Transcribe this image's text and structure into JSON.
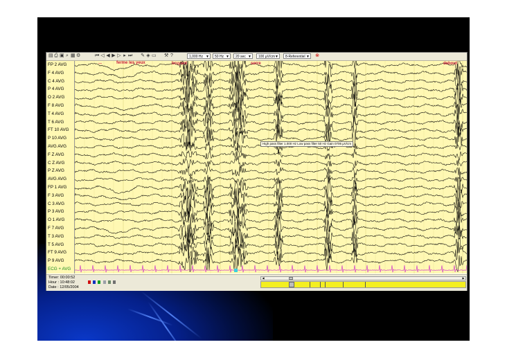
{
  "toolbar": {
    "icons": [
      "open-icon",
      "print-icon",
      "save-icon",
      "zoom-icon",
      "montage-icon",
      "settings-icon",
      "first-page-icon",
      "previous-icon",
      "back-icon",
      "play-icon",
      "forward-icon",
      "next-icon",
      "last-page-icon",
      "marker-icon",
      "filter-icon",
      "video-icon",
      "tools-icon",
      "help-icon"
    ],
    "high_pass": "1,000 Hz",
    "low_pass": "50 Hz",
    "time_base": "20 sec",
    "gain": "100 µV/cm",
    "montage": "8-Referentiel"
  },
  "channels": [
    "FP 2 AVG",
    "F 4 AVG",
    "C 4 AVG",
    "P 4 AVG",
    "O 2 AVG",
    "F 8 AVG",
    "T 4 AVG",
    "T 6 AVG",
    "FT 10 AVG",
    "P 10 AVG",
    "AVG AVG",
    "F Z AVG",
    "C Z AVG",
    "P Z AVG",
    "AVG AVG",
    "FP 1 AVG",
    "F 3 AVG",
    "C 3 AVG",
    "P 3 AVG",
    "O 1 AVG",
    "F 7 AVG",
    "T 3 AVG",
    "T 5 AVG",
    "FT 9 AVG",
    "P 9 AVG",
    "ECG + AVG"
  ],
  "annotations": [
    "...",
    "ferme les yeux",
    "bruyant",
    "serre",
    "debout"
  ],
  "filter_info": "High pass filter 1.000 Hz   Low pass filter 50 Hz   Gain 0706 µV/cm",
  "status": {
    "timer": "Timer: 00:00:52",
    "hour": "Hour :  10:48:02",
    "date": "Date :  12/05/2004"
  },
  "colors": {
    "trace_bg": "#fff8b3",
    "trace_line": "#000000",
    "ecg_line": "#d23cc8",
    "annotation": "#c81a3c",
    "timeline": "#f4ef20"
  }
}
